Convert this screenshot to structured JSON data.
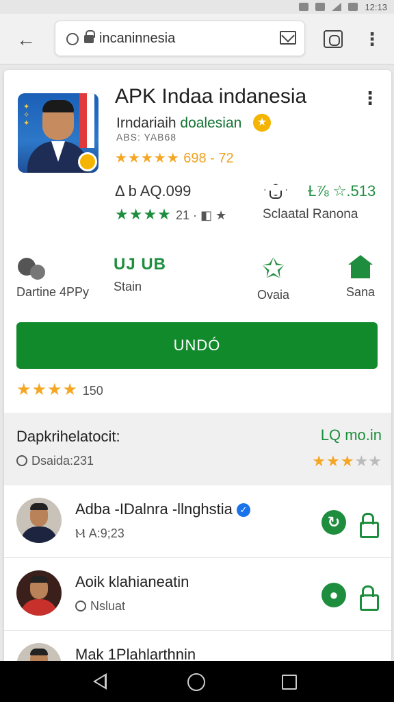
{
  "status_bar": {
    "time": "12:13"
  },
  "browser": {
    "url": "incaninnesia"
  },
  "app": {
    "title": "APK Indaa indanesia",
    "developer_main": "Irndariaih ",
    "developer_green": "doalesian",
    "subline": "ABS: YAB68",
    "rating_stars": "★★★★★",
    "rating_text": "698 - 72",
    "stat1_text": "Δ  b AQ.099",
    "stat1_stars": "★★★★",
    "stat1_extra": "21 · ◧ ★",
    "stat2_text": "Ɫ⅞ ☆.513",
    "stat2_label": "Sclaatal Ranona"
  },
  "actions": [
    {
      "label": "Dartine 4PPy",
      "icon": "gears-icon"
    },
    {
      "label": "Stain",
      "top": "UJ UB"
    },
    {
      "label": "Ovaia",
      "icon": "star-outline-icon"
    },
    {
      "label": "Sana",
      "icon": "home-icon"
    }
  ],
  "install_button": {
    "label": "UNDÓ"
  },
  "bottom_rating": {
    "stars": "★★★★",
    "count": "150"
  },
  "info": {
    "title": "Dapkrihelatocit:",
    "subtitle": "Dsaida:231",
    "right_label": "LQ mo.in",
    "stars_filled": "★★★",
    "stars_empty": "★★"
  },
  "list": [
    {
      "name": "Adba -IDalnra -llnghstia",
      "sub": "Ⲙ A:9;23",
      "verified": true
    },
    {
      "name": "Aoik klahianeatin",
      "sub": "Nsluat",
      "verified": false
    },
    {
      "name": "Mak 1Plahlarthnin",
      "sub": "",
      "verified": false
    }
  ],
  "colors": {
    "accent_green": "#108a2b",
    "star_yellow": "#f5a623",
    "verified_blue": "#1a73e8"
  }
}
